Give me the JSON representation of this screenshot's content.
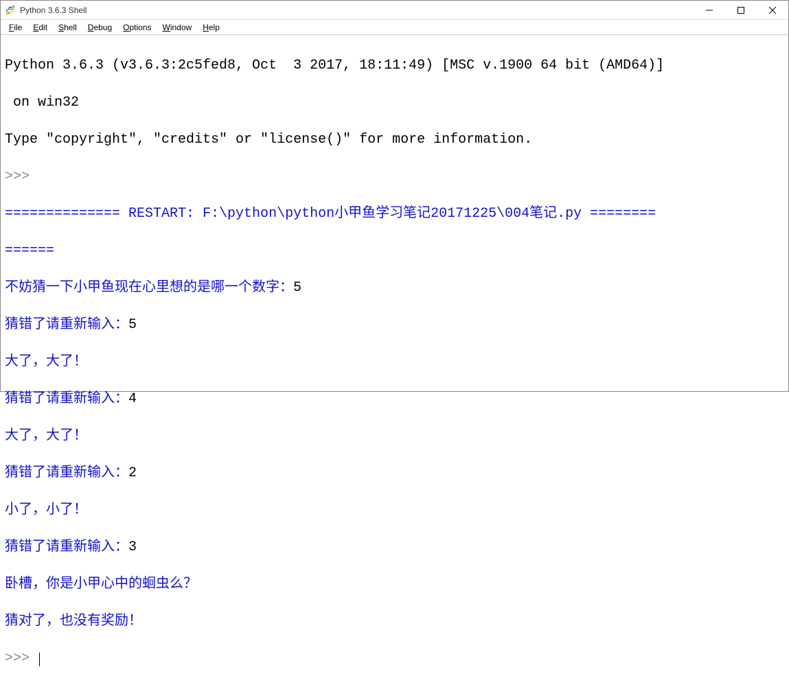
{
  "window": {
    "title": "Python 3.6.3 Shell"
  },
  "menus": {
    "file": "File",
    "file_u": "F",
    "edit": "Edit",
    "edit_u": "E",
    "shell": "Shell",
    "shell_u": "S",
    "debug": "Debug",
    "debug_u": "D",
    "options": "Options",
    "options_u": "O",
    "window": "Window",
    "window_u": "W",
    "help": "Help",
    "help_u": "H"
  },
  "shell": {
    "banner1": "Python 3.6.3 (v3.6.3:2c5fed8, Oct  3 2017, 18:11:49) [MSC v.1900 64 bit (AMD64)]",
    "banner2": " on win32",
    "banner3": "Type \"copyright\", \"credits\" or \"license()\" for more information.",
    "prompt": ">>> ",
    "restart1": "============== RESTART: F:\\python\\python小甲鱼学习笔记20171225\\004笔记.py ========",
    "restart2": "======",
    "q1_prompt": "不妨猜一下小甲鱼现在心里想的是哪一个数字：",
    "q1_input": "5",
    "wrong_prompt": "猜错了请重新输入：",
    "in2": "5",
    "big": "大了，大了！",
    "in3": "4",
    "in4": "2",
    "small": "小了，小了！",
    "in5": "3",
    "win1": "卧槽，你是小甲心中的蛔虫么？",
    "win2": "猜对了，也没有奖励！"
  }
}
